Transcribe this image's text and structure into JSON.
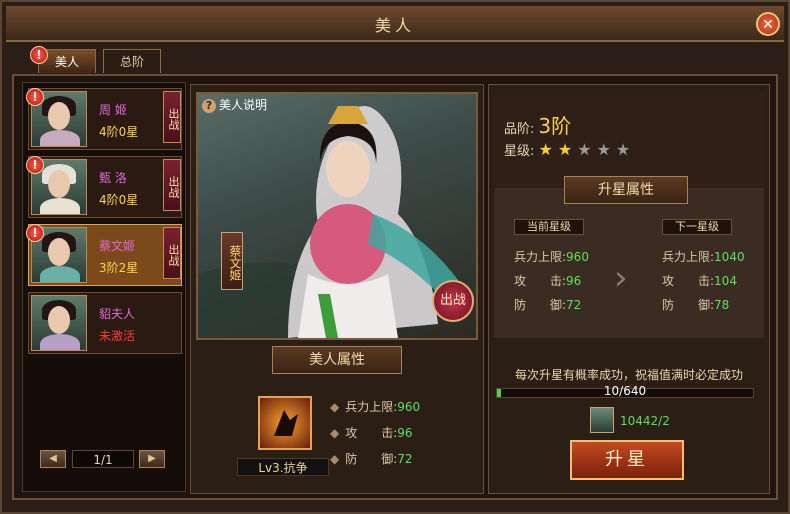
{
  "window": {
    "title": "美人",
    "close_glyph": "✕"
  },
  "tabs": [
    {
      "label": "美人",
      "active": true
    },
    {
      "label": "总阶",
      "active": false
    }
  ],
  "alert_glyph": "!",
  "list": [
    {
      "name": "周 姬",
      "level": "4阶0星",
      "fight": "出战",
      "alert": true,
      "selected": false,
      "locked": false
    },
    {
      "name": "甄 洛",
      "level": "4阶0星",
      "fight": "出战",
      "alert": true,
      "selected": false,
      "locked": false
    },
    {
      "name": "蔡文姬",
      "level": "3阶2星",
      "fight": "出战",
      "alert": true,
      "selected": true,
      "locked": false
    },
    {
      "name": "貂夫人",
      "level": "未激活",
      "fight": "",
      "alert": false,
      "selected": false,
      "locked": true
    }
  ],
  "pager": {
    "text": "1/1",
    "prev": "◀",
    "next": "▶"
  },
  "middle": {
    "help_label": "美人说明",
    "help_icon": "?",
    "beauty_name": "蔡文姬",
    "fight_button": "出战",
    "section_title": "美人属性",
    "skill_label": "Lv3.抗争",
    "attrs": [
      {
        "label": "兵力上限:",
        "value": "960"
      },
      {
        "label": "攻　　击:",
        "value": "96"
      },
      {
        "label": "防　　御:",
        "value": "72"
      }
    ],
    "bullet": "◆"
  },
  "right": {
    "grade_label": "品阶:",
    "grade_value": "3阶",
    "star_label": "星级:",
    "stars": {
      "filled": 2,
      "total": 5,
      "glyph": "★",
      "filled_color": "#ffcf2a",
      "empty_color": "#9a9a9a"
    },
    "section_title": "升星属性",
    "current_head": "当前星级",
    "next_head": "下一星级",
    "current": [
      {
        "label": "兵力上限:",
        "value": "960"
      },
      {
        "label": "攻　　击:",
        "value": "96"
      },
      {
        "label": "防　　御:",
        "value": "72"
      }
    ],
    "next": [
      {
        "label": "兵力上限:",
        "value": "1040"
      },
      {
        "label": "攻　　击:",
        "value": "104"
      },
      {
        "label": "防　　御:",
        "value": "78"
      }
    ],
    "arrow_glyph": "›",
    "note": "每次升星有概率成功，祝福值满时必定成功",
    "progress_text": "10/640",
    "progress": 0.016,
    "item_count": "10442/2",
    "upgrade_button": "升星"
  }
}
